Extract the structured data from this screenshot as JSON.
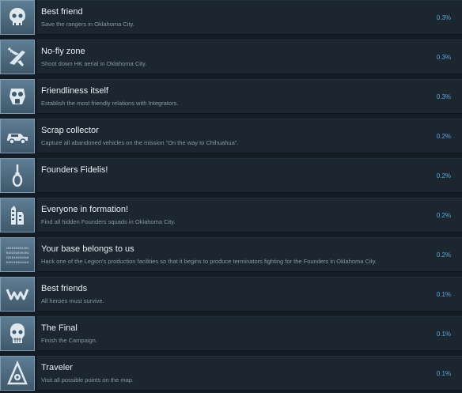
{
  "achievements": [
    {
      "title": "Best friend",
      "description": "Save the rangers in Oklahoma City.",
      "percent": "0.3%",
      "icon": "skull-icon"
    },
    {
      "title": "No-fly zone",
      "description": "Shoot down HK aerial in Oklahoma City.",
      "percent": "0.3%",
      "icon": "aircraft-crash-icon"
    },
    {
      "title": "Friendliness itself",
      "description": "Establish the most friendly relations with Integrators.",
      "percent": "0.3%",
      "icon": "gasmask-icon"
    },
    {
      "title": "Scrap collector",
      "description": "Capture all abandoned vehicles on the mission “On the way to Chihuahua”.",
      "percent": "0.2%",
      "icon": "car-icon"
    },
    {
      "title": "Founders Fidelis!",
      "description": "",
      "percent": "0.2%",
      "icon": "noose-icon"
    },
    {
      "title": "Everyone in formation!",
      "description": "Find all hidden Founders squads in Oklahoma City.",
      "percent": "0.2%",
      "icon": "ruined-building-icon"
    },
    {
      "title": "Your base belongs to us",
      "description": "Hack one of the Legion's production facilities so that it begins to produce terminators fighting for the Founders in Oklahoma City.",
      "percent": "0.2%",
      "icon": "binary-code-icon",
      "icon_text": "101010101101 010101010101 101010101010 010110101010"
    },
    {
      "title": "Best friends",
      "description": "All heroes must survive.",
      "percent": "0.1%",
      "icon": "hands-icon"
    },
    {
      "title": "The Final",
      "description": "Finish the Campaign.",
      "percent": "0.1%",
      "icon": "terminator-skull-icon"
    },
    {
      "title": "Traveler",
      "description": "Visit all possible points on the map.",
      "percent": "0.1%",
      "icon": "map-pin-gear-icon"
    }
  ],
  "colors": {
    "background": "#141c26",
    "panel": "#1b2631",
    "title": "#e9eef2",
    "description": "#8a97a4",
    "percent": "#5ea7d9",
    "icon_bg": "#4f6b80"
  }
}
